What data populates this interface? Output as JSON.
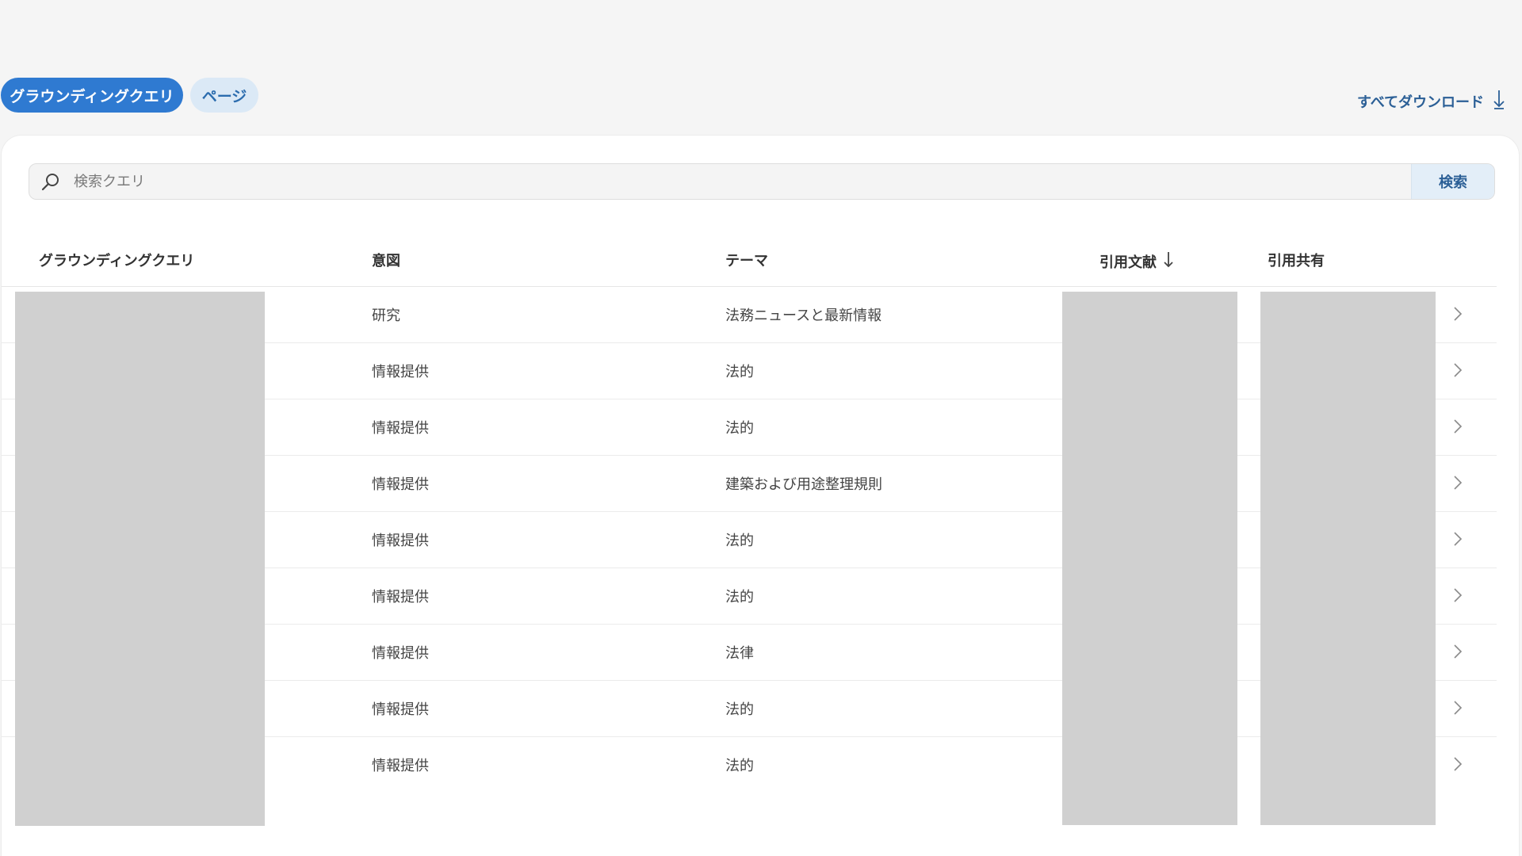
{
  "tabs": [
    {
      "label": "グラウンディングクエリ",
      "active": true
    },
    {
      "label": "ページ",
      "active": false
    }
  ],
  "download": {
    "label": "すべてダウンロード",
    "icon": "arrow-down-icon"
  },
  "search": {
    "placeholder": "検索クエリ",
    "value": "",
    "button_label": "検索",
    "icon": "search-icon"
  },
  "table": {
    "columns": [
      {
        "label": "グラウンディングクエリ"
      },
      {
        "label": "意図"
      },
      {
        "label": "テーマ"
      },
      {
        "label": "引用文献",
        "sort": "descending"
      },
      {
        "label": "引用共有"
      }
    ],
    "rows": [
      {
        "intent": "研究",
        "theme": "法務ニュースと最新情報"
      },
      {
        "intent": "情報提供",
        "theme": "法的"
      },
      {
        "intent": "情報提供",
        "theme": "法的"
      },
      {
        "intent": "情報提供",
        "theme": "建築および用途整理規則"
      },
      {
        "intent": "情報提供",
        "theme": "法的"
      },
      {
        "intent": "情報提供",
        "theme": "法的"
      },
      {
        "intent": "情報提供",
        "theme": "法律"
      },
      {
        "intent": "情報提供",
        "theme": "法的"
      },
      {
        "intent": "情報提供",
        "theme": "法的"
      }
    ]
  },
  "colors": {
    "accent": "#2f7ad1",
    "accent_light": "#dbe9f6",
    "link": "#2b5f96",
    "background": "#f5f5f5",
    "redaction": "#d0d0d0"
  }
}
